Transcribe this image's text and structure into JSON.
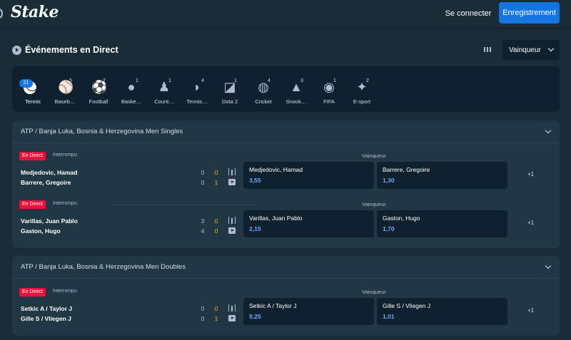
{
  "brand": {
    "logo_text": "Stake"
  },
  "header": {
    "login_label": "Se connecter",
    "register_label": "Enregistrement"
  },
  "section": {
    "title": "Événements en Direct"
  },
  "market_select": {
    "value": "Vainqueur"
  },
  "sports": [
    {
      "label": "Tennis",
      "count": "21",
      "icon": "tennis-icon",
      "active": true
    },
    {
      "label": "Baseb…",
      "count": "5",
      "icon": "baseball-icon"
    },
    {
      "label": "Football",
      "count": "2",
      "icon": "football-icon"
    },
    {
      "label": "Baske…",
      "count": "1",
      "icon": "basketball-icon"
    },
    {
      "label": "Count…",
      "count": "1",
      "icon": "counter-strike-icon"
    },
    {
      "label": "Tennis…",
      "count": "4",
      "icon": "table-tennis-icon"
    },
    {
      "label": "Dota 2",
      "count": "1",
      "icon": "dota2-icon"
    },
    {
      "label": "Cricket",
      "count": "4",
      "icon": "cricket-icon"
    },
    {
      "label": "Snook…",
      "count": "3",
      "icon": "snooker-icon"
    },
    {
      "label": "FIFA",
      "count": "1",
      "icon": "fifa-icon"
    },
    {
      "label": "E-sport",
      "count": "2",
      "icon": "esport-icon"
    }
  ],
  "events": [
    {
      "title": "ATP / Banja Luka, Bosnia & Herzegovina Men Singles",
      "matches": [
        {
          "live": "En Direct",
          "status": "Interrompu",
          "market": "Vainqueur",
          "team1": "Medjedovic, Hamad",
          "team2": "Barrere, Gregoire",
          "score1_sets": "0",
          "score1_games": "0",
          "score2_sets": "0",
          "score2_games": "1",
          "odds1_name": "Medjedovic, Hamad",
          "odds1": "3,55",
          "odds2_name": "Barrere, Gregoire",
          "odds2": "1,30",
          "more": "+1"
        },
        {
          "live": "En Direct",
          "status": "Interrompu",
          "market": "Vainqueur",
          "team1": "Varillas, Juan Pablo",
          "team2": "Gaston, Hugo",
          "score1_sets": "3",
          "score1_games": "0",
          "score2_sets": "4",
          "score2_games": "0",
          "odds1_name": "Varillas, Juan Pablo",
          "odds1": "2,15",
          "odds2_name": "Gaston, Hugo",
          "odds2": "1,70",
          "more": "+1"
        }
      ]
    },
    {
      "title": "ATP / Banja Luka, Bosnia & Herzegovina Men Doubles",
      "matches": [
        {
          "live": "En Direct",
          "status": "Interrompu",
          "market": "Vainqueur",
          "team1": "Setkic A / Taylor J",
          "team2": "Gille S / Vliegen J",
          "score1_sets": "0",
          "score1_games": "0",
          "score2_sets": "0",
          "score2_games": "1",
          "odds1_name": "Setkic A / Taylor J",
          "odds1": "9,25",
          "odds2_name": "Gille S / Vliegen J",
          "odds2": "1,01",
          "more": "+1"
        }
      ]
    }
  ],
  "colors": {
    "background": "#1a2c38",
    "panel": "#213743",
    "dark": "#0f212e",
    "accent": "#1475e1",
    "live": "#e9113c",
    "score": "#ffa726"
  }
}
